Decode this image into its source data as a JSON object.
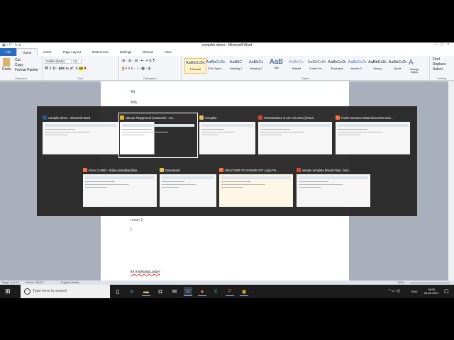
{
  "window": {
    "title": "compiler demo - Microsoft Word"
  },
  "tabs": [
    "File",
    "Home",
    "Insert",
    "Page Layout",
    "References",
    "Mailings",
    "Review",
    "View"
  ],
  "ribbon": {
    "clipboard": {
      "paste": "Paste",
      "cut": "Cut",
      "copy": "Copy",
      "format_painter": "Format Painter",
      "label": "Clipboard"
    },
    "font": {
      "name": "Calibri (Body)",
      "size": "11",
      "label": "Font"
    },
    "paragraph": {
      "label": "Paragraph"
    },
    "styles": {
      "label": "Styles",
      "items": [
        {
          "sample": "AaBbCcDc",
          "name": "¶ Normal"
        },
        {
          "sample": "AaBbCcDc",
          "name": "¶ No Spaci..."
        },
        {
          "sample": "AaBbC",
          "name": "Heading 1"
        },
        {
          "sample": "AaBbCc",
          "name": "Heading 2"
        },
        {
          "sample": "AaB",
          "name": "Title"
        },
        {
          "sample": "AaBbCc.",
          "name": "Subtitle"
        },
        {
          "sample": "AaBbCcDı",
          "name": "Subtle Em..."
        },
        {
          "sample": "AaBbCcDı",
          "name": "Emphasis"
        },
        {
          "sample": "AaBbCcDı",
          "name": "Intense E..."
        },
        {
          "sample": "AaBbCcDı",
          "name": "Strong"
        },
        {
          "sample": "AaBbCcDı",
          "name": "Quote"
        }
      ],
      "change_styles": "Change Styles"
    },
    "editing": {
      "find": "Find",
      "replace": "Replace",
      "select": "Select",
      "label": "Editing"
    }
  },
  "document": {
    "lines_top": [
      "%}",
      "%%"
    ],
    "lines_bottom": [
      "return 1;",
      "}",
      "int main(argc,argv)"
    ]
  },
  "status": {
    "page": "Page: 8 of 13",
    "words": "Words: 28/417",
    "language": "English (India)",
    "zoom": "110%"
  },
  "alttab": {
    "row1": [
      {
        "title": "compiler demo - Microsoft Word",
        "color": "#2b5797"
      },
      {
        "title": "Ubuntu Playground | Katacoda - Go...",
        "color": "#e8b31a"
      },
      {
        "title": "Compiler",
        "color": "#e8c04a"
      },
      {
        "title": "Presentation1 on 23 Feb 2021 [Read...",
        "color": "#d04a2a"
      },
      {
        "title": "Fresh Resource Material and Recordi...",
        "color": "#ff7139"
      }
    ],
    "row2": [
      {
        "title": "Inbox (1,880) - shilpa.pimpalkar@ais...",
        "color": "#ff7139"
      },
      {
        "title": "Downloads",
        "color": "#e8c04a"
      },
      {
        "title": "WELCOME TO AISSMS IOIT Login Pa...",
        "color": "#ff7139"
      },
      {
        "title": "sample template [Read-Only] - Micr...",
        "color": "#d04a2a"
      }
    ]
  },
  "taskbar": {
    "search_placeholder": "Type here to search",
    "time": "18:08",
    "date": "26-02-2021",
    "lang": "ENG"
  }
}
